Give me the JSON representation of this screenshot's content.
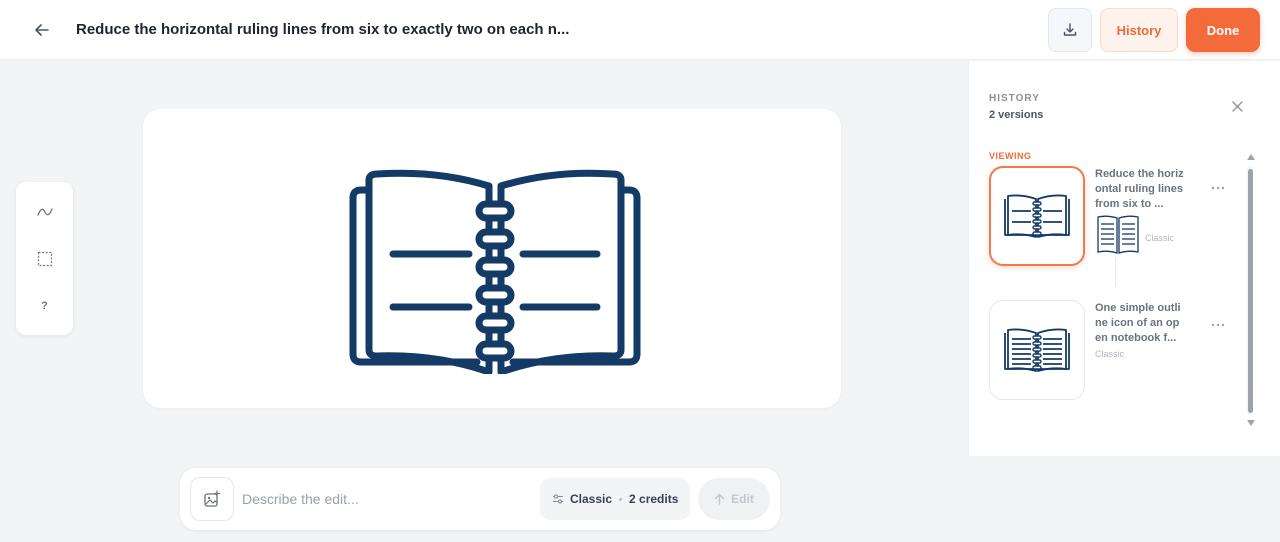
{
  "header": {
    "title": "Reduce the horizontal ruling lines from six to exactly two on each n...",
    "history_label": "History",
    "done_label": "Done",
    "icons": {
      "back": "arrow-left-icon",
      "download": "download-icon"
    }
  },
  "tools": {
    "items": [
      {
        "name": "draw-tool",
        "icon": "squiggle-icon"
      },
      {
        "name": "select-tool",
        "icon": "dashed-rectangle-icon"
      },
      {
        "name": "help-tool",
        "label": "?"
      }
    ]
  },
  "prompt_bar": {
    "placeholder": "Describe the edit...",
    "value": "",
    "mode": "Classic",
    "credits": "2 credits",
    "edit_label": "Edit"
  },
  "history_panel": {
    "title": "HISTORY",
    "count": "2 versions",
    "viewing_label": "VIEWING",
    "versions": [
      {
        "text": "Reduce the horizontal ruling lines from six to ...",
        "mode": "Classic",
        "active": true
      },
      {
        "text": "One simple outline icon of an open notebook f...",
        "mode": "Classic",
        "active": false
      }
    ]
  },
  "colors": {
    "accent": "#f36b3b",
    "icon_navy": "#143a66",
    "background": "#f3f4f6"
  }
}
